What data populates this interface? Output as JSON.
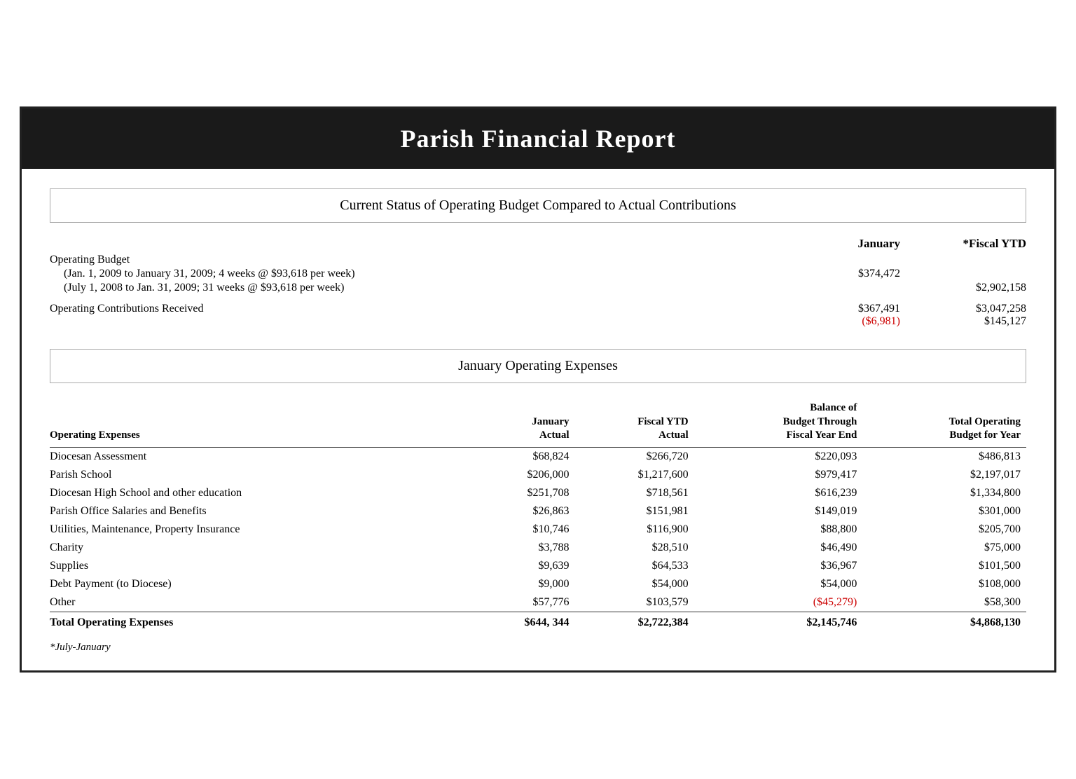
{
  "header": {
    "title": "Parish Financial Report"
  },
  "section1": {
    "title": "Current Status of Operating Budget Compared to Actual Contributions",
    "col_jan": "January",
    "col_ytd": "*Fiscal YTD",
    "rows": [
      {
        "label": "Operating Budget",
        "indent": false,
        "jan": "",
        "ytd": ""
      },
      {
        "label": "(Jan. 1, 2009 to January 31, 2009; 4 weeks @ $93,618 per week)",
        "indent": true,
        "jan": "$374,472",
        "ytd": ""
      },
      {
        "label": "(July 1, 2008 to Jan. 31, 2009; 31 weeks @ $93,618 per week)",
        "indent": true,
        "jan": "",
        "ytd": "$2,902,158"
      }
    ],
    "contributions_label": "Operating Contributions Received",
    "contributions_jan": "$367,491",
    "contributions_jan_diff": "($6,981)",
    "contributions_ytd": "$3,047,258",
    "contributions_ytd_diff": "$145,127"
  },
  "section2": {
    "title": "January Operating Expenses",
    "col_label": "Operating Expenses",
    "col_jan": "January\nActual",
    "col_ytd": "Fiscal YTD\nActual",
    "col_balance": "Balance of\nBudget Through\nFiscal Year End",
    "col_total": "Total Operating\nBudget for Year",
    "rows": [
      {
        "label": "Diocesan Assessment",
        "jan": "$68,824",
        "ytd": "$266,720",
        "balance": "$220,093",
        "total": "$486,813",
        "negative_balance": false
      },
      {
        "label": "Parish School",
        "jan": "$206,000",
        "ytd": "$1,217,600",
        "balance": "$979,417",
        "total": "$2,197,017",
        "negative_balance": false
      },
      {
        "label": "Diocesan High School and other education",
        "jan": "$251,708",
        "ytd": "$718,561",
        "balance": "$616,239",
        "total": "$1,334,800",
        "negative_balance": false
      },
      {
        "label": "Parish Office Salaries and Benefits",
        "jan": "$26,863",
        "ytd": "$151,981",
        "balance": "$149,019",
        "total": "$301,000",
        "negative_balance": false
      },
      {
        "label": "Utilities, Maintenance, Property Insurance",
        "jan": "$10,746",
        "ytd": "$116,900",
        "balance": "$88,800",
        "total": "$205,700",
        "negative_balance": false
      },
      {
        "label": "Charity",
        "jan": "$3,788",
        "ytd": "$28,510",
        "balance": "$46,490",
        "total": "$75,000",
        "negative_balance": false
      },
      {
        "label": "Supplies",
        "jan": "$9,639",
        "ytd": "$64,533",
        "balance": "$36,967",
        "total": "$101,500",
        "negative_balance": false
      },
      {
        "label": "Debt Payment (to Diocese)",
        "jan": "$9,000",
        "ytd": "$54,000",
        "balance": "$54,000",
        "total": "$108,000",
        "negative_balance": false
      },
      {
        "label": "Other",
        "jan": "$57,776",
        "ytd": "$103,579",
        "balance": "($45,279)",
        "total": "$58,300",
        "negative_balance": true
      }
    ],
    "total_row": {
      "label": "Total Operating Expenses",
      "jan": "$644, 344",
      "ytd": "$2,722,384",
      "balance": "$2,145,746",
      "total": "$4,868,130"
    },
    "footer_note": "*July-January"
  }
}
